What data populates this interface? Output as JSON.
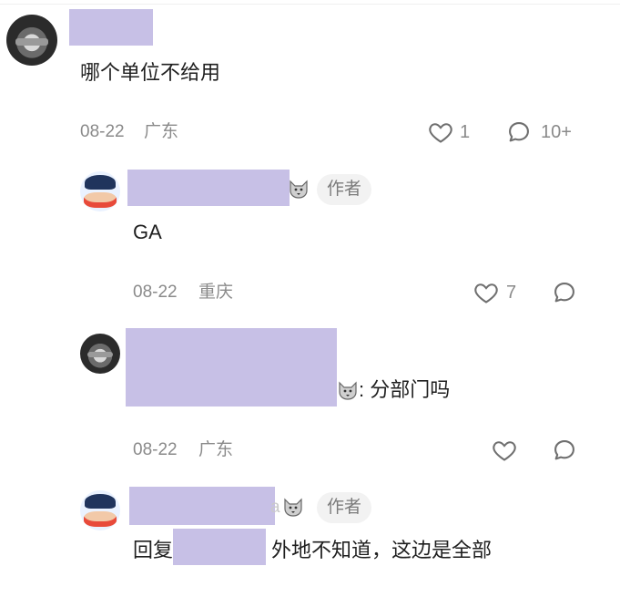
{
  "comments": [
    {
      "text": "哪个单位不给用",
      "date": "08-22",
      "location": "广东",
      "likes": "1",
      "replies": "10+"
    },
    {
      "badge": "作者",
      "text": "GA",
      "date": "08-22",
      "location": "重庆",
      "likes": "7"
    },
    {
      "quote_suffix": ": 分部门吗",
      "date": "08-22",
      "location": "广东"
    },
    {
      "name_fragment": "a",
      "badge": "作者",
      "reply_prefix": "回复",
      "reply_text": "外地不知道，这边是全部"
    }
  ],
  "icons": [
    "heart-icon",
    "comment-icon",
    "wolf-emoji-icon"
  ]
}
